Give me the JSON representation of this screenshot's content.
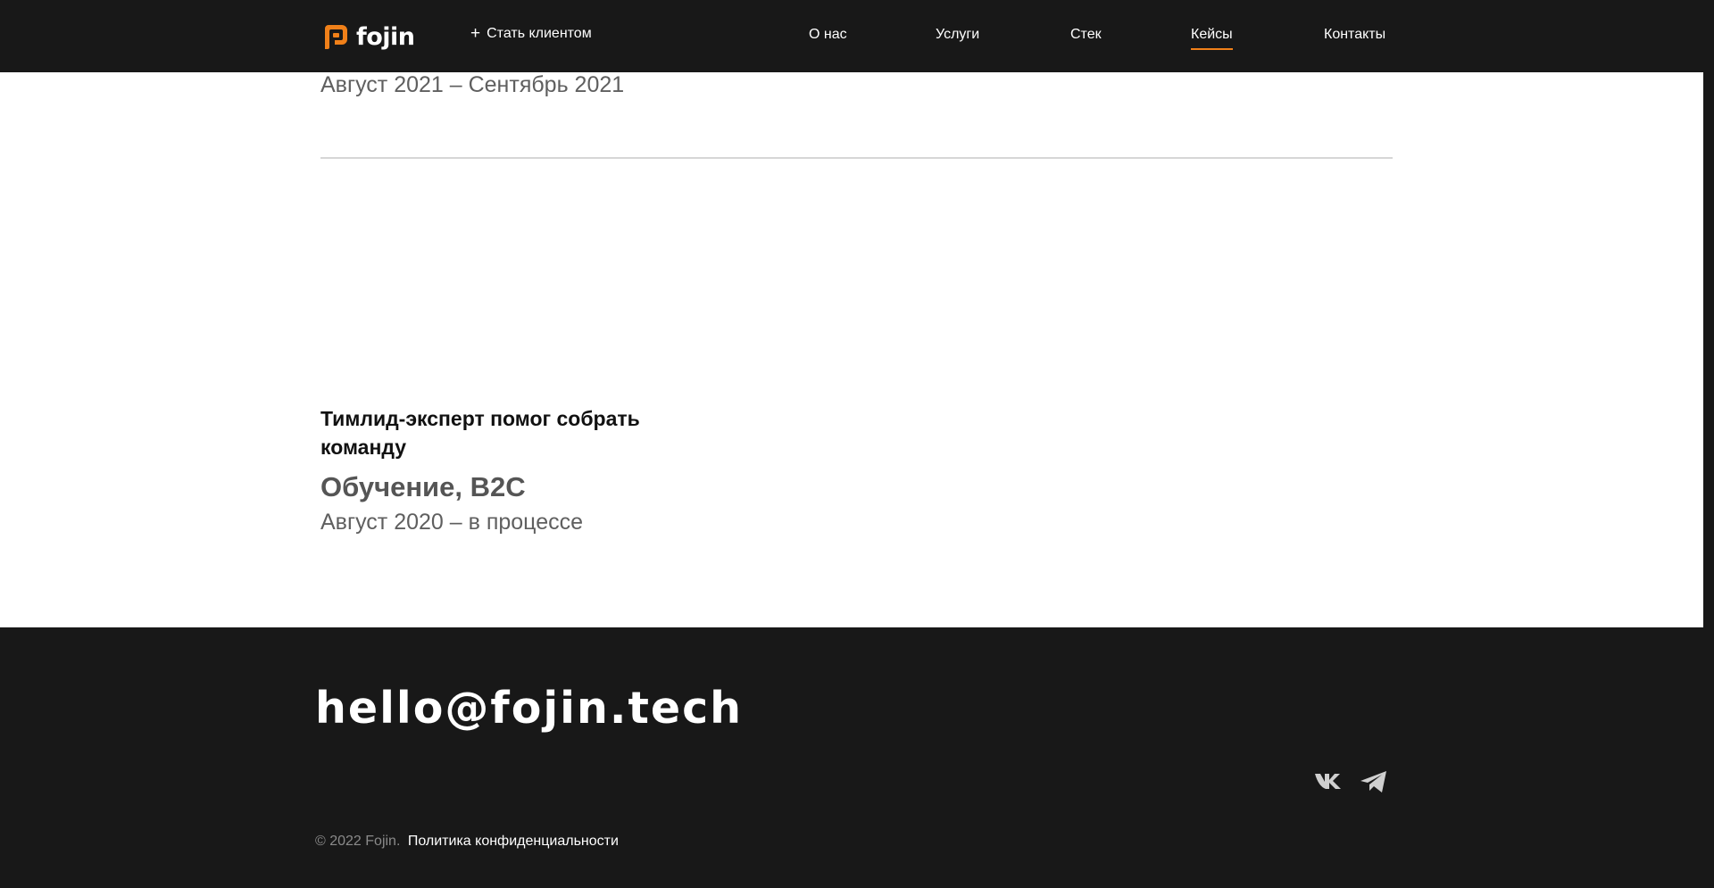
{
  "header": {
    "logo_text": "fojin",
    "cta": {
      "icon": "plus-icon",
      "label": "Стать клиентом"
    },
    "nav": [
      {
        "label": "О нас",
        "active": false
      },
      {
        "label": "Услуги",
        "active": false
      },
      {
        "label": "Стек",
        "active": false
      },
      {
        "label": "Кейсы",
        "active": true
      },
      {
        "label": "Контакты",
        "active": false
      }
    ]
  },
  "cases": {
    "previous_date": "Август 2021 – Сентябрь 2021",
    "current": {
      "title": "Тимлид-эксперт помог собрать команду",
      "category": "Обучение, B2C",
      "date": "Август 2020 – в процессе"
    }
  },
  "footer": {
    "email": "hello@fojin.tech",
    "social": [
      {
        "icon": "vk-icon"
      },
      {
        "icon": "telegram-icon"
      }
    ],
    "copyright": "© 2022 Fojin.",
    "policy_link": "Политика конфиденциальности"
  },
  "colors": {
    "background_dark": "#181818",
    "accent": "#f08019",
    "content_bg": "#ffffff",
    "muted_text": "#5f5f5f"
  }
}
